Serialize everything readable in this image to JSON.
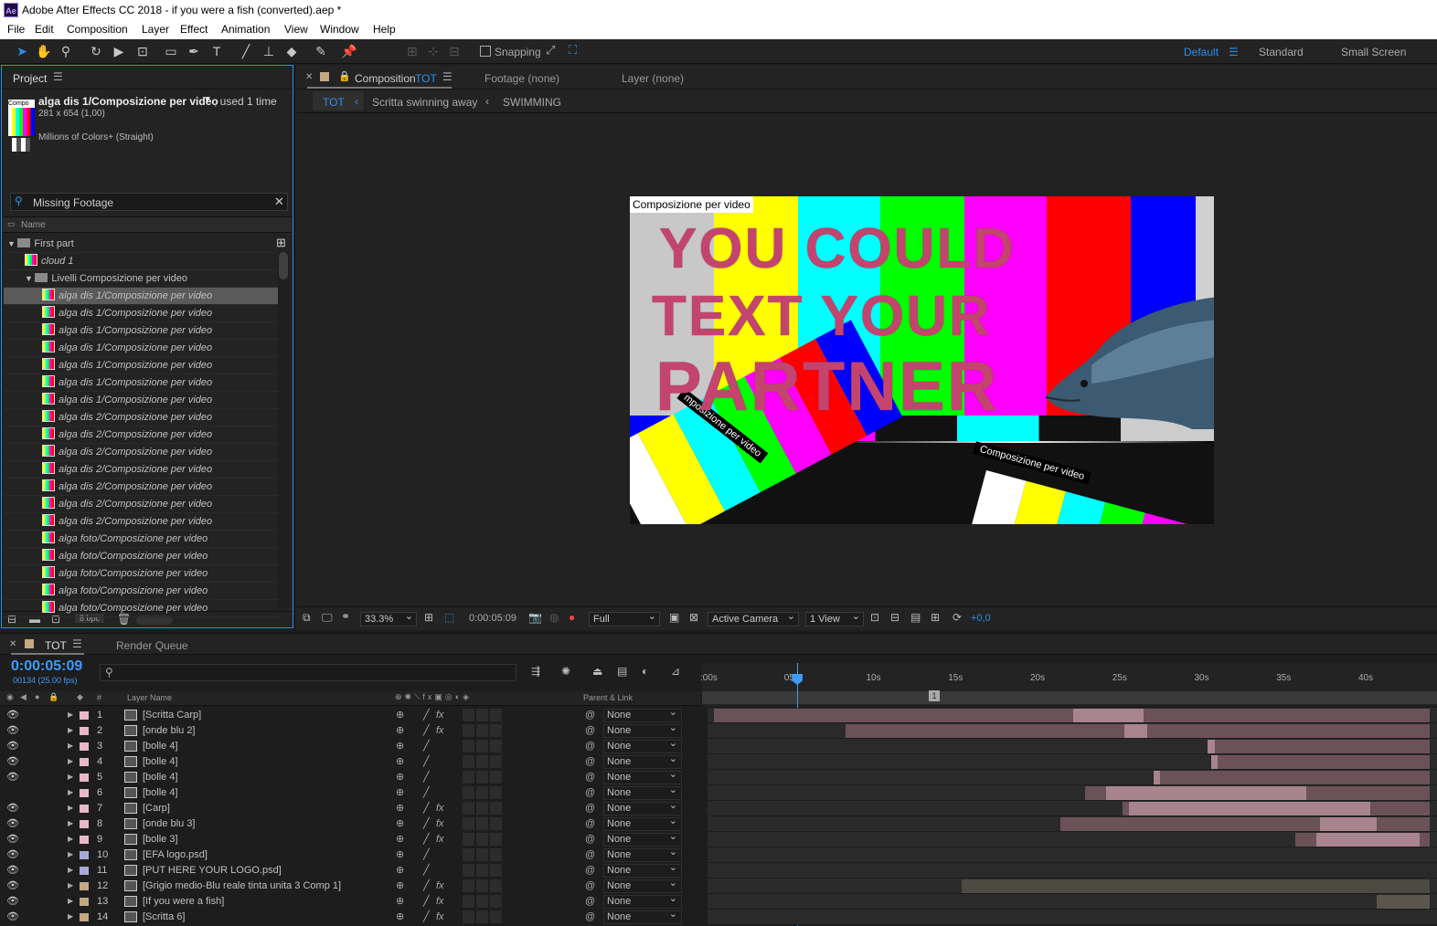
{
  "window": {
    "title": "Adobe After Effects CC 2018 - if you were a fish (converted).aep *",
    "app_icon": "Ae"
  },
  "menu": [
    "File",
    "Edit",
    "Composition",
    "Layer",
    "Effect",
    "Animation",
    "View",
    "Window",
    "Help"
  ],
  "toolbar": {
    "snapping": "Snapping",
    "workspaces": [
      "Default",
      "Standard",
      "Small Screen"
    ],
    "active_workspace": "Default"
  },
  "project": {
    "panel_title": "Project",
    "selected_name": "alga dis 1/Composizione per video",
    "used": ", used 1 time",
    "dims": "281 x 654 (1,00)",
    "colors": "Millions of Colors+ (Straight)",
    "thumb_label": "Compo",
    "search": "Missing Footage",
    "col_name": "Name",
    "bpc": "8 bpc",
    "rows": [
      {
        "type": "folder",
        "indent": 0,
        "name": "First part"
      },
      {
        "type": "comp",
        "indent": 1,
        "name": "cloud 1"
      },
      {
        "type": "folder",
        "indent": 1,
        "name": "Livelli Composizione per video"
      },
      {
        "type": "comp",
        "indent": 2,
        "name": "alga dis 1/Composizione per video",
        "selected": true
      },
      {
        "type": "comp",
        "indent": 2,
        "name": "alga dis 1/Composizione per video"
      },
      {
        "type": "comp",
        "indent": 2,
        "name": "alga dis 1/Composizione per video"
      },
      {
        "type": "comp",
        "indent": 2,
        "name": "alga dis 1/Composizione per video"
      },
      {
        "type": "comp",
        "indent": 2,
        "name": "alga dis 1/Composizione per video"
      },
      {
        "type": "comp",
        "indent": 2,
        "name": "alga dis 1/Composizione per video"
      },
      {
        "type": "comp",
        "indent": 2,
        "name": "alga dis 1/Composizione per video"
      },
      {
        "type": "comp",
        "indent": 2,
        "name": "alga dis 2/Composizione per video"
      },
      {
        "type": "comp",
        "indent": 2,
        "name": "alga dis 2/Composizione per video"
      },
      {
        "type": "comp",
        "indent": 2,
        "name": "alga dis 2/Composizione per video"
      },
      {
        "type": "comp",
        "indent": 2,
        "name": "alga dis 2/Composizione per video"
      },
      {
        "type": "comp",
        "indent": 2,
        "name": "alga dis 2/Composizione per video"
      },
      {
        "type": "comp",
        "indent": 2,
        "name": "alga dis 2/Composizione per video"
      },
      {
        "type": "comp",
        "indent": 2,
        "name": "alga dis 2/Composizione per video"
      },
      {
        "type": "comp",
        "indent": 2,
        "name": "alga foto/Composizione per video"
      },
      {
        "type": "comp",
        "indent": 2,
        "name": "alga foto/Composizione per video"
      },
      {
        "type": "comp",
        "indent": 2,
        "name": "alga foto/Composizione per video"
      },
      {
        "type": "comp",
        "indent": 2,
        "name": "alga foto/Composizione per video"
      },
      {
        "type": "comp",
        "indent": 2,
        "name": "alga foto/Composizione per video"
      }
    ]
  },
  "composition": {
    "tab": "Composition",
    "tab_name": "TOT",
    "footage": "Footage (none)",
    "layer": "Layer (none)",
    "breadcrumbs": [
      "TOT",
      "Scritta swinning away",
      "SWIMMING"
    ],
    "comp_label": "Composizione per video",
    "band_label": "Composizione per video",
    "band_label2": "mposizione per video",
    "line1": "YOU COULD",
    "line2": "TEXT YOUR",
    "line3": "PARTNER",
    "zoom": "33.3%",
    "timecode": "0:00:05:09",
    "resolution": "Full",
    "camera": "Active Camera",
    "views": "1 View",
    "exposure": "+0,0"
  },
  "timeline": {
    "tab": "TOT",
    "render_queue": "Render Queue",
    "timecode": "0:00:05:09",
    "fps": "00134 (25.00 fps)",
    "col_layer_name": "Layer Name",
    "col_parent": "Parent & Link",
    "col_num": "#",
    "ticks": [
      ":00s",
      "05s",
      "10s",
      "15s",
      "20s",
      "25s",
      "30s",
      "35s",
      "40s"
    ],
    "marker": "1",
    "current_time_s": 5.36,
    "layers": [
      {
        "num": "1",
        "name": "[Scritta Carp]",
        "color": "#e8b8c8",
        "fx": true,
        "visible": true,
        "parent": "None",
        "in": 0.4,
        "out": 44,
        "hi_in": 22.3,
        "hi_out": 26.6,
        "bar": "#6b5158",
        "hi": "#a8848f"
      },
      {
        "num": "2",
        "name": "[onde blu 2]",
        "color": "#e8b8c8",
        "fx": true,
        "visible": true,
        "parent": "None",
        "in": 8.4,
        "out": 44,
        "hi_in": 25.4,
        "hi_out": 26.8,
        "bar": "#6b5158",
        "hi": "#a8848f"
      },
      {
        "num": "3",
        "name": "[bolle 4]",
        "color": "#e8b8c8",
        "fx": false,
        "visible": true,
        "parent": "None",
        "in": 30.5,
        "out": 44,
        "hi_in": 30.5,
        "hi_out": 30.9,
        "bar": "#6b5158",
        "hi": "#a8848f"
      },
      {
        "num": "4",
        "name": "[bolle 4]",
        "color": "#e8b8c8",
        "fx": false,
        "visible": true,
        "parent": "None",
        "in": 30.7,
        "out": 44,
        "hi_in": 30.7,
        "hi_out": 31.1,
        "bar": "#6b5158",
        "hi": "#a8848f"
      },
      {
        "num": "5",
        "name": "[bolle 4]",
        "color": "#e8b8c8",
        "fx": false,
        "visible": true,
        "parent": "None",
        "in": 27.2,
        "out": 44,
        "hi_in": 27.2,
        "hi_out": 27.6,
        "bar": "#6b5158",
        "hi": "#a8848f"
      },
      {
        "num": "6",
        "name": "[bolle 4]",
        "color": "#e8b8c8",
        "fx": false,
        "visible": false,
        "parent": "None",
        "in": 23.0,
        "out": 44,
        "hi_in": 24.3,
        "hi_out": 36.5,
        "bar": "#6b5158",
        "hi": "#a8848f"
      },
      {
        "num": "7",
        "name": "[Carp]",
        "color": "#e8b8c8",
        "fx": true,
        "visible": true,
        "parent": "None",
        "in": 25.3,
        "out": 44,
        "hi_in": 25.7,
        "hi_out": 40.4,
        "bar": "#6b5158",
        "hi": "#a8848f"
      },
      {
        "num": "8",
        "name": "[onde blu 3]",
        "color": "#e8b8c8",
        "fx": true,
        "visible": true,
        "parent": "None",
        "in": 21.5,
        "out": 44,
        "hi_in": 37.3,
        "hi_out": 40.8,
        "bar": "#6b5158",
        "hi": "#a8848f"
      },
      {
        "num": "9",
        "name": "[bolle 3]",
        "color": "#e8b8c8",
        "fx": true,
        "visible": true,
        "parent": "None",
        "in": 35.8,
        "out": 44,
        "hi_in": 37.1,
        "hi_out": 43.4,
        "bar": "#6b5158",
        "hi": "#a8848f"
      },
      {
        "num": "10",
        "name": "[EFA logo.psd]",
        "color": "#a9a9d6",
        "fx": false,
        "visible": true,
        "parent": "None",
        "in": 0,
        "out": 0,
        "hi_in": 0,
        "hi_out": 0,
        "bar": "#2a2a2a",
        "hi": "#2a2a2a"
      },
      {
        "num": "11",
        "name": "[PUT HERE YOUR LOGO.psd]",
        "color": "#a9a9d6",
        "fx": false,
        "visible": true,
        "parent": "None",
        "in": 0,
        "out": 0,
        "hi_in": 0,
        "hi_out": 0,
        "bar": "#2a2a2a",
        "hi": "#2a2a2a"
      },
      {
        "num": "12",
        "name": "[Grigio medio-Blu reale tinta unita 3 Comp 1]",
        "color": "#c4a882",
        "fx": true,
        "visible": true,
        "parent": "None",
        "in": 15.5,
        "out": 44,
        "hi_in": 0,
        "hi_out": 0,
        "bar": "#4d4a43",
        "hi": "#4d4a43"
      },
      {
        "num": "13",
        "name": "[If you were a fish]",
        "color": "#c4a882",
        "fx": true,
        "visible": true,
        "parent": "None",
        "in": 40.8,
        "out": 44,
        "hi_in": 0,
        "hi_out": 0,
        "bar": "#5a564d",
        "hi": "#5a564d"
      },
      {
        "num": "14",
        "name": "[Scritta 6]",
        "color": "#c4a882",
        "fx": true,
        "visible": true,
        "parent": "None",
        "in": 0,
        "out": 0,
        "hi_in": 0,
        "hi_out": 0,
        "bar": "#2a2a2a",
        "hi": "#2a2a2a"
      }
    ]
  }
}
